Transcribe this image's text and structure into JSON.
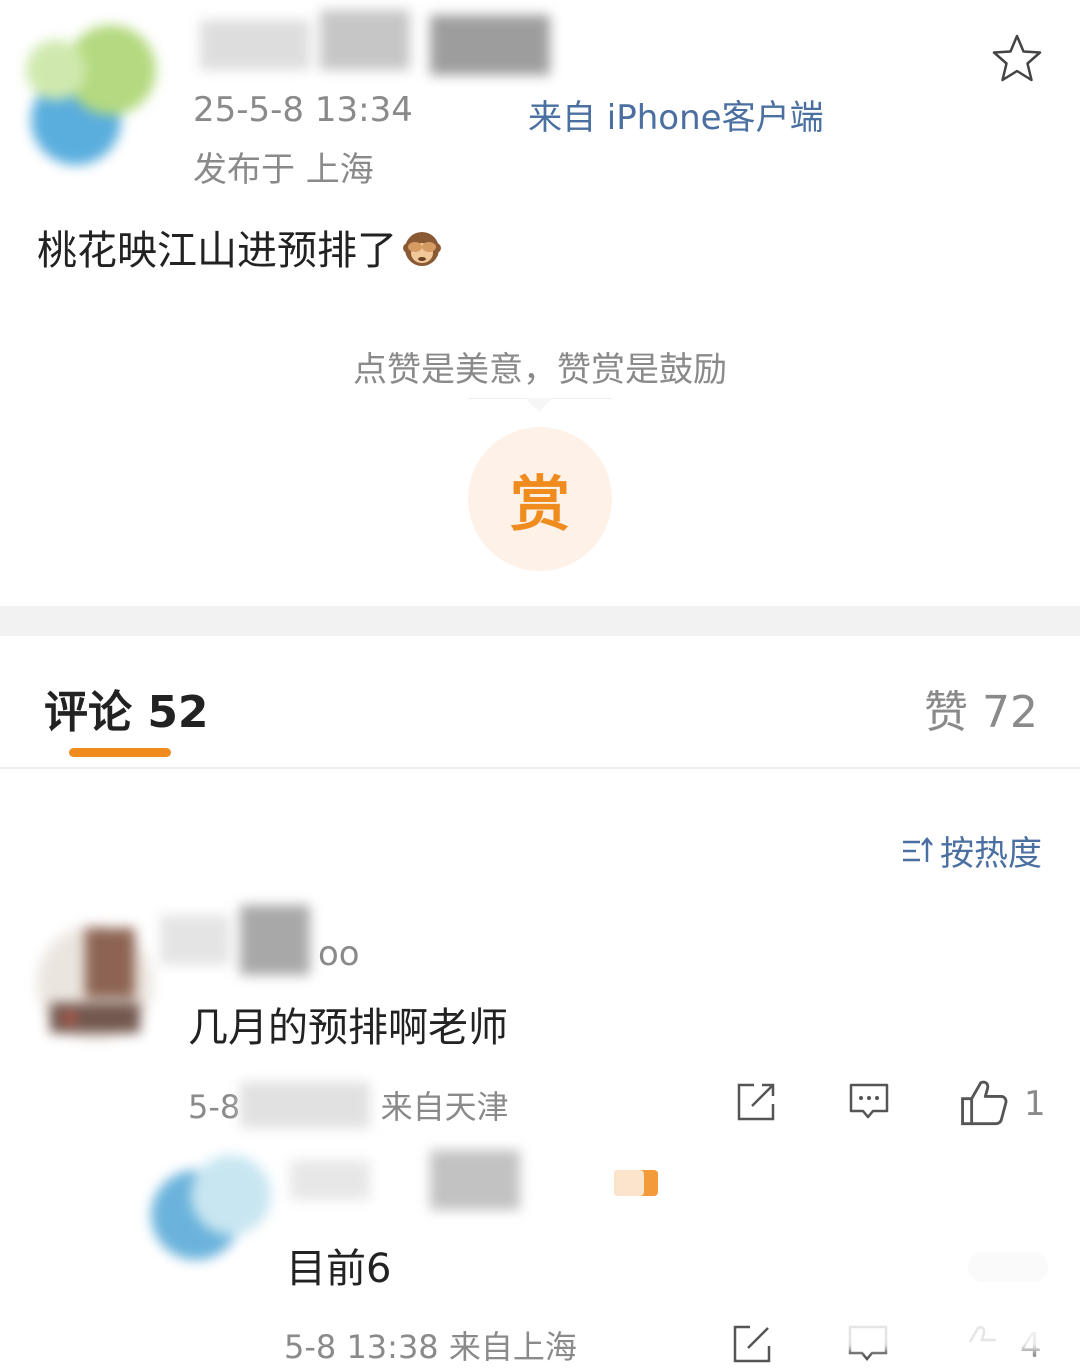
{
  "post": {
    "time": "25-5-8 13:34",
    "source": "来自 iPhone客户端",
    "location": "发布于 上海",
    "body": "桃花映江山进预排了",
    "emoji": "see-no-evil-monkey-icon"
  },
  "reward": {
    "hint": "点赞是美意，赞赏是鼓励",
    "button_label": "赏"
  },
  "tabs": {
    "comments_label": "评论 52",
    "likes_label": "赞 72"
  },
  "sort": {
    "label": "按热度"
  },
  "comments": [
    {
      "name_visible": "oo",
      "text": "几月的预排啊老师",
      "time": "5-8",
      "location": "来自天津",
      "likes": "1"
    }
  ],
  "reply": {
    "text": "目前6",
    "time": "5-8 13:38 来自上海",
    "likes": "4"
  },
  "colors": {
    "accent": "#f08c1e",
    "link": "#4a6fa0",
    "muted": "#8a8a8a"
  }
}
